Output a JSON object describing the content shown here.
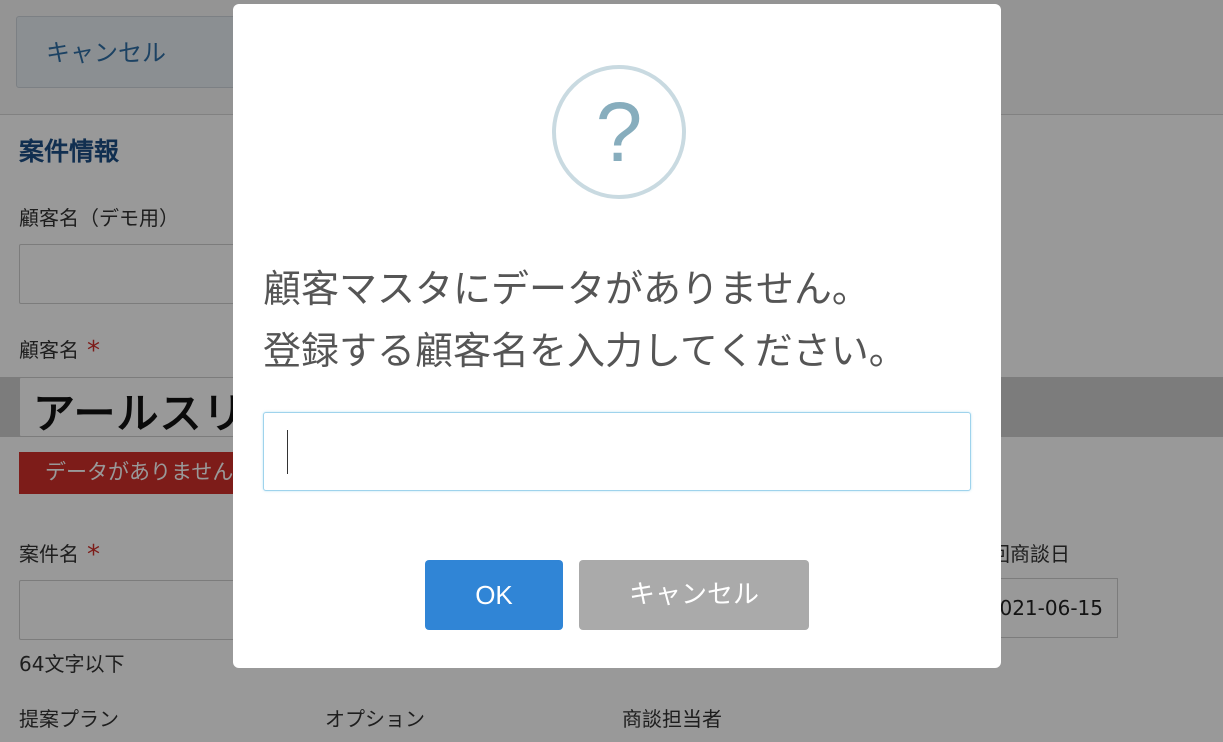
{
  "background": {
    "top_cancel_label": "キャンセル",
    "section_title": "案件情報",
    "customer_name_demo_label": "顧客名（デモ用）",
    "customer_name_label": "顧客名",
    "required_mark": "*",
    "customer_name_value": "アールスリ",
    "error_message": "データがありません",
    "project_name_label": "案件名",
    "max_length_note": "64文字以下",
    "meeting_date_label": "回商談日",
    "meeting_date_value": "021-06-15",
    "proposal_plan_label": "提案プラン",
    "option_label": "オプション",
    "sales_rep_label": "商談担当者"
  },
  "dialog": {
    "icon": "question-icon",
    "icon_glyph": "?",
    "message_line1": "顧客マスタにデータがありません。",
    "message_line2": "登録する顧客名を入力してください。",
    "input_value": "",
    "ok_label": "OK",
    "cancel_label": "キャンセル"
  },
  "colors": {
    "accent": "#3085d6",
    "error": "#d0302a",
    "cancel_button": "#aaaaaa",
    "heading": "#1d4f86"
  }
}
